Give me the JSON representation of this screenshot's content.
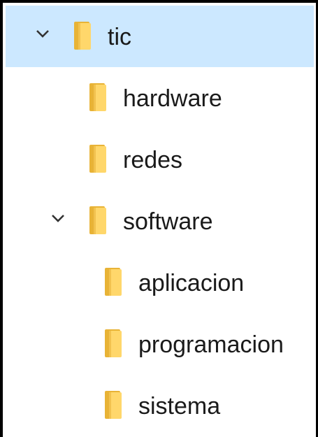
{
  "tree": {
    "nodes": [
      {
        "label": "tic",
        "level": 0,
        "expanded": true,
        "selected": true,
        "icon": "folder-icon",
        "chevron": "chevron-down-icon"
      },
      {
        "label": "hardware",
        "level": 1,
        "expanded": false,
        "selected": false,
        "icon": "folder-icon"
      },
      {
        "label": "redes",
        "level": 1,
        "expanded": false,
        "selected": false,
        "icon": "folder-icon"
      },
      {
        "label": "software",
        "level": 1,
        "expanded": true,
        "selected": false,
        "icon": "folder-icon",
        "chevron": "chevron-down-icon"
      },
      {
        "label": "aplicacion",
        "level": 2,
        "expanded": false,
        "selected": false,
        "icon": "folder-icon"
      },
      {
        "label": "programacion",
        "level": 2,
        "expanded": false,
        "selected": false,
        "icon": "folder-icon"
      },
      {
        "label": "sistema",
        "level": 2,
        "expanded": false,
        "selected": false,
        "icon": "folder-icon"
      }
    ]
  },
  "colors": {
    "selection": "#cce8ff",
    "folder_light": "#ffd76b",
    "folder_dark": "#e8b336"
  }
}
